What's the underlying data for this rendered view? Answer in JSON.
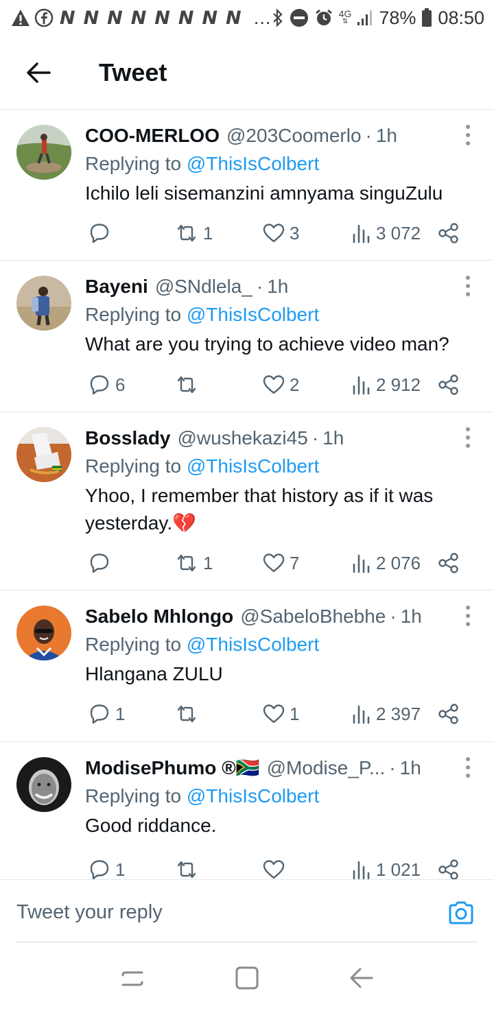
{
  "status_bar": {
    "battery": "78%",
    "time": "08:50",
    "network": "4G",
    "notification_icons": [
      "warning-icon",
      "facebook-icon",
      "n-icon",
      "n-icon",
      "n-icon",
      "n-icon",
      "n-icon",
      "n-icon",
      "n-icon",
      "n-icon"
    ],
    "more": "…"
  },
  "header": {
    "title": "Tweet"
  },
  "replying_label": "Replying to",
  "tweets": [
    {
      "name": "COO-MERLOO",
      "handle": "@203Coomerlo",
      "time": "1h",
      "reply_to": "@ThisIsColbert",
      "text": "Ichilo leli sisemanzini amnyama singuZulu",
      "replies": "",
      "retweets": "1",
      "likes": "3",
      "views": "3 072"
    },
    {
      "name": "Bayeni",
      "handle": "@SNdlela_",
      "time": "1h",
      "reply_to": "@ThisIsColbert",
      "text": "What are you trying to achieve video man?",
      "replies": "6",
      "retweets": "",
      "likes": "2",
      "views": "2 912"
    },
    {
      "name": "Bosslady",
      "handle": "@wushekazi45",
      "time": "1h",
      "reply_to": "@ThisIsColbert",
      "text": "Yhoo, I remember that history as if it was yesterday.💔",
      "replies": "",
      "retweets": "1",
      "likes": "7",
      "views": "2 076"
    },
    {
      "name": "Sabelo Mhlongo",
      "handle": "@SabeloBhebhe",
      "time": "1h",
      "reply_to": "@ThisIsColbert",
      "text": "Hlangana ZULU",
      "replies": "1",
      "retweets": "",
      "likes": "1",
      "views": "2 397"
    },
    {
      "name": "ModisePhumo ®🇿🇦",
      "handle": "@Modise_P...",
      "time": "1h",
      "reply_to": "@ThisIsColbert",
      "text": "Good riddance.",
      "replies": "1",
      "retweets": "",
      "likes": "",
      "views": "1 021"
    }
  ],
  "reply_bar": {
    "placeholder": "Tweet your reply"
  },
  "colors": {
    "accent": "#1d9bf0",
    "secondary_text": "#536471",
    "primary_text": "#0f1419"
  }
}
